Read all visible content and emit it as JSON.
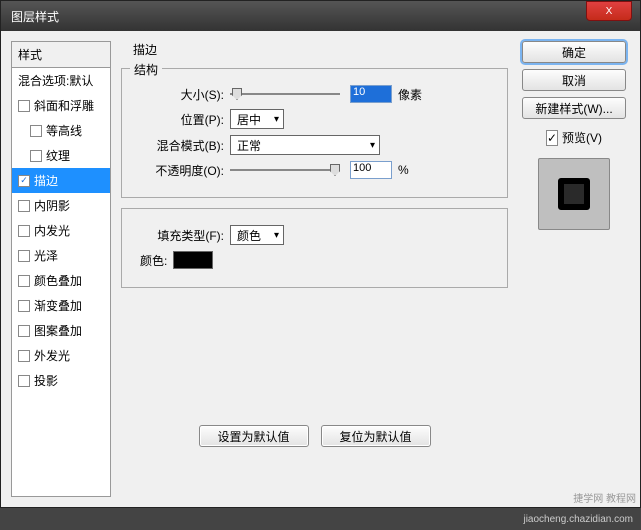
{
  "window": {
    "title": "图层样式",
    "close_x": "X"
  },
  "left": {
    "header": "样式",
    "blend_opts": "混合选项:默认",
    "items": [
      {
        "label": "斜面和浮雕",
        "checked": false,
        "indent": false
      },
      {
        "label": "等高线",
        "checked": false,
        "indent": true
      },
      {
        "label": "纹理",
        "checked": false,
        "indent": true
      },
      {
        "label": "描边",
        "checked": true,
        "indent": false,
        "selected": true
      },
      {
        "label": "内阴影",
        "checked": false,
        "indent": false
      },
      {
        "label": "内发光",
        "checked": false,
        "indent": false
      },
      {
        "label": "光泽",
        "checked": false,
        "indent": false
      },
      {
        "label": "颜色叠加",
        "checked": false,
        "indent": false
      },
      {
        "label": "渐变叠加",
        "checked": false,
        "indent": false
      },
      {
        "label": "图案叠加",
        "checked": false,
        "indent": false
      },
      {
        "label": "外发光",
        "checked": false,
        "indent": false
      },
      {
        "label": "投影",
        "checked": false,
        "indent": false
      }
    ]
  },
  "panel": {
    "title": "描边",
    "structure_legend": "结构",
    "size_label": "大小(S):",
    "size_value": "10",
    "size_unit": "像素",
    "position_label": "位置(P):",
    "position_value": "居中",
    "blend_label": "混合模式(B):",
    "blend_value": "正常",
    "opacity_label": "不透明度(O):",
    "opacity_value": "100",
    "opacity_unit": "%",
    "fill_legend_empty": "",
    "fill_type_label": "填充类型(F):",
    "fill_type_value": "颜色",
    "color_label": "颜色:",
    "color_value": "#000000",
    "make_default": "设置为默认值",
    "reset_default": "复位为默认值"
  },
  "right": {
    "ok": "确定",
    "cancel": "取消",
    "new_style": "新建样式(W)...",
    "preview_label": "预览(V)",
    "preview_checked": true
  },
  "watermark": "捷学网 教程网",
  "footer_url": "jiaocheng.chazidian.com"
}
